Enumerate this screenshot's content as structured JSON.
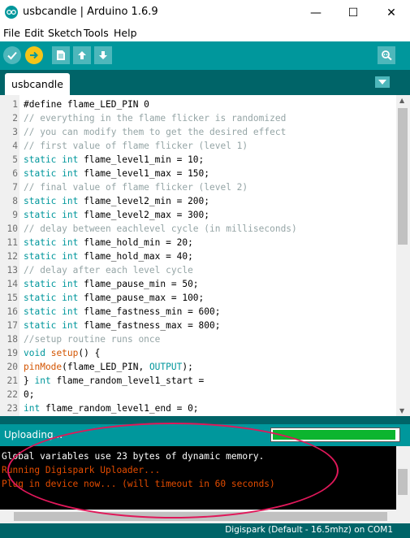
{
  "window": {
    "title": "usbcandle | Arduino 1.6.9",
    "minimize_glyph": "—",
    "maximize_glyph": "☐",
    "close_glyph": "✕"
  },
  "menu": [
    "File",
    "Edit",
    "Sketch",
    "Tools",
    "Help"
  ],
  "toolbar": {
    "buttons": [
      "verify-icon",
      "upload-icon",
      "new-icon",
      "open-icon",
      "save-icon"
    ],
    "serial_monitor": "serial-monitor-icon"
  },
  "tabs": [
    {
      "label": "usbcandle",
      "active": true
    }
  ],
  "colors": {
    "teal": "#00979c",
    "dark_teal": "#006468",
    "keyword": "#00979c",
    "function": "#d35400",
    "comment": "#95a5a6",
    "console_error": "#e34c00",
    "progress": "#0cb52f"
  },
  "editor": {
    "lines": [
      {
        "n": "1",
        "parts": [
          {
            "t": "#define flame_LED_PIN 0",
            "c": "plain"
          }
        ]
      },
      {
        "n": "2",
        "parts": [
          {
            "t": "// everything in the flame flicker is randomized",
            "c": "comment"
          }
        ]
      },
      {
        "n": "3",
        "parts": [
          {
            "t": "// you can modify them to get the desired effect",
            "c": "comment"
          }
        ]
      },
      {
        "n": "4",
        "parts": [
          {
            "t": "// first value of flame flicker (level 1)",
            "c": "comment"
          }
        ]
      },
      {
        "n": "5",
        "parts": [
          {
            "t": "static int",
            "c": "kw"
          },
          {
            "t": " flame_level1_min = 10;",
            "c": "plain"
          }
        ]
      },
      {
        "n": "6",
        "parts": [
          {
            "t": "static int",
            "c": "kw"
          },
          {
            "t": " flame_level1_max = 150;",
            "c": "plain"
          }
        ]
      },
      {
        "n": "7",
        "parts": [
          {
            "t": "// final value of flame flicker (level 2)",
            "c": "comment"
          }
        ]
      },
      {
        "n": "8",
        "parts": [
          {
            "t": "static int",
            "c": "kw"
          },
          {
            "t": " flame_level2_min = 200;",
            "c": "plain"
          }
        ]
      },
      {
        "n": "9",
        "parts": [
          {
            "t": "static int",
            "c": "kw"
          },
          {
            "t": " flame_level2_max = 300;",
            "c": "plain"
          }
        ]
      },
      {
        "n": "10",
        "parts": [
          {
            "t": "// delay between eachlevel cycle (in milliseconds)",
            "c": "comment"
          }
        ]
      },
      {
        "n": "11",
        "parts": [
          {
            "t": "static int",
            "c": "kw"
          },
          {
            "t": " flame_hold_min = 20;",
            "c": "plain"
          }
        ]
      },
      {
        "n": "12",
        "parts": [
          {
            "t": "static int",
            "c": "kw"
          },
          {
            "t": " flame_hold_max = 40;",
            "c": "plain"
          }
        ]
      },
      {
        "n": "13",
        "parts": [
          {
            "t": "// delay after each level cycle",
            "c": "comment"
          }
        ]
      },
      {
        "n": "14",
        "parts": [
          {
            "t": "static int",
            "c": "kw"
          },
          {
            "t": " flame_pause_min = 50;",
            "c": "plain"
          }
        ]
      },
      {
        "n": "15",
        "parts": [
          {
            "t": "static int",
            "c": "kw"
          },
          {
            "t": " flame_pause_max = 100;",
            "c": "plain"
          }
        ]
      },
      {
        "n": "16",
        "parts": [
          {
            "t": "static int",
            "c": "kw"
          },
          {
            "t": " flame_fastness_min = 600;",
            "c": "plain"
          }
        ]
      },
      {
        "n": "17",
        "parts": [
          {
            "t": "static int",
            "c": "kw"
          },
          {
            "t": " flame_fastness_max = 800;",
            "c": "plain"
          }
        ]
      },
      {
        "n": "18",
        "parts": [
          {
            "t": "//setup routine runs once",
            "c": "comment"
          }
        ]
      },
      {
        "n": "19",
        "parts": [
          {
            "t": "void",
            "c": "kw"
          },
          {
            "t": " ",
            "c": "plain"
          },
          {
            "t": "setup",
            "c": "fn"
          },
          {
            "t": "() {",
            "c": "plain"
          }
        ]
      },
      {
        "n": "20",
        "parts": [
          {
            "t": "pinMode",
            "c": "fn"
          },
          {
            "t": "(flame_LED_PIN, ",
            "c": "plain"
          },
          {
            "t": "OUTPUT",
            "c": "kw"
          },
          {
            "t": ");",
            "c": "plain"
          }
        ]
      },
      {
        "n": "21",
        "parts": [
          {
            "t": "} ",
            "c": "plain"
          },
          {
            "t": "int",
            "c": "kw"
          },
          {
            "t": " flame_random_level1_start =",
            "c": "plain"
          }
        ]
      },
      {
        "n": "22",
        "parts": [
          {
            "t": "0;",
            "c": "plain"
          }
        ]
      },
      {
        "n": "23",
        "parts": [
          {
            "t": "int",
            "c": "kw"
          },
          {
            "t": " flame_random_level1_end = 0;",
            "c": "plain"
          }
        ]
      }
    ]
  },
  "status": {
    "text": "Uploading...",
    "progress": 0.98
  },
  "console": {
    "lines": [
      {
        "text": "Global variables use 23 bytes of dynamic memory.",
        "color": "#ffffff"
      },
      {
        "text": "Running Digispark Uploader...",
        "color": "#e34c00"
      },
      {
        "text": "Plug in device now... (will timeout in 60 seconds)",
        "color": "#e34c00"
      }
    ]
  },
  "footer": {
    "board": "Digispark (Default - 16.5mhz) on COM1"
  }
}
